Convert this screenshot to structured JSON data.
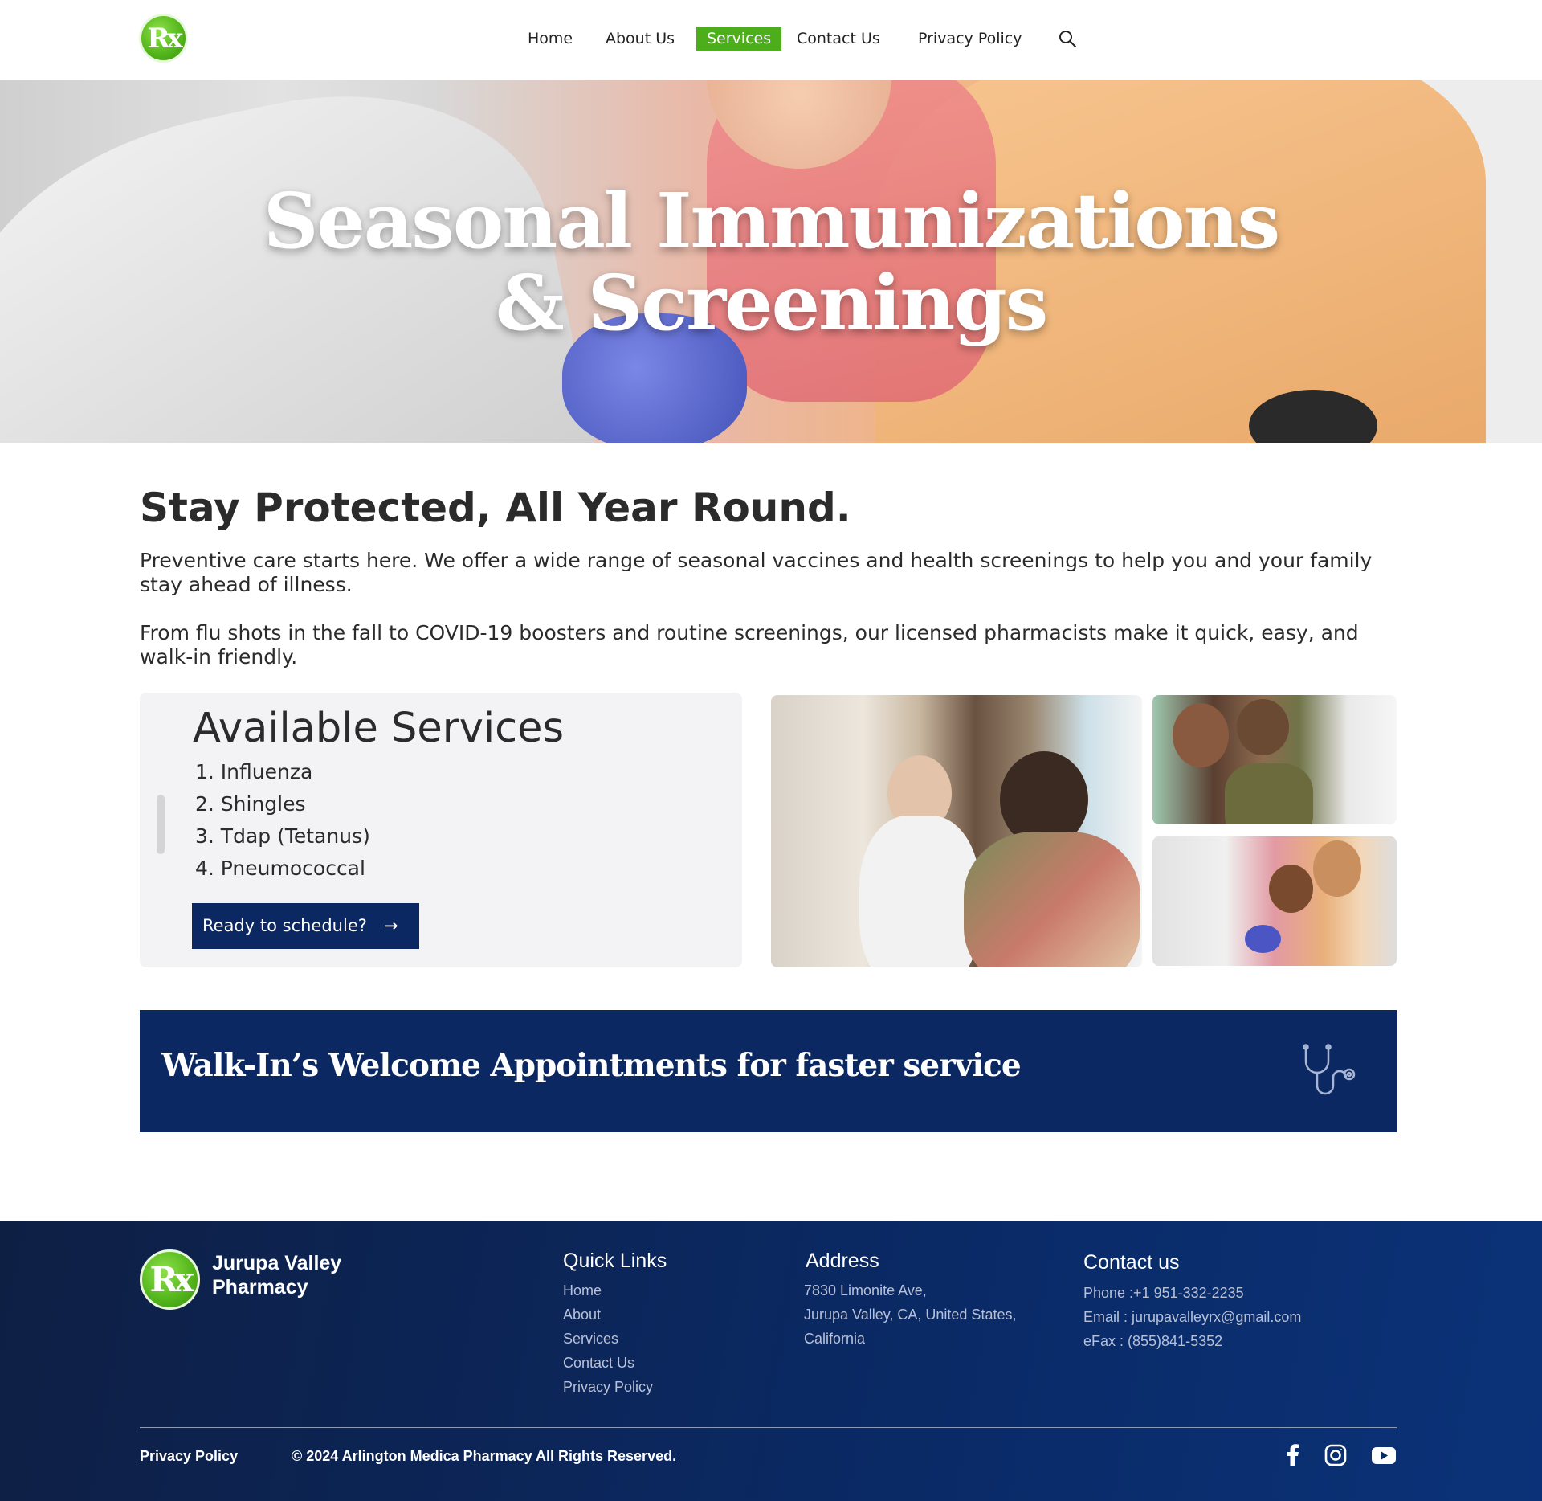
{
  "header": {
    "logo_text": "Rx",
    "nav": [
      "Home",
      "About Us",
      "Services",
      "Contact Us",
      "Privacy Policy"
    ],
    "active_nav": "Services",
    "accent_color": "#4cae1a"
  },
  "hero": {
    "title_line1": "Seasonal Immunizations",
    "title_line2": "& Screenings"
  },
  "intro": {
    "heading": "Stay Protected, All Year Round.",
    "paragraph1": "Preventive care starts here. We offer a wide range of seasonal vaccines and health screenings to help you and your family stay ahead of illness.",
    "paragraph2": "From flu shots in the fall to COVID-19 boosters and routine screenings, our licensed pharmacists make it quick, easy, and walk-in friendly."
  },
  "services": {
    "title": "Available Services",
    "items": [
      "1.  Influenza",
      "2. Shingles",
      "3. Tdap (Tetanus)",
      "4. Pneumococcal"
    ],
    "cta_label": "Ready to schedule?",
    "cta_arrow": "→"
  },
  "banner": {
    "text": "Walk-In’s Welcome Appointments for faster service",
    "icon": "stethoscope-icon",
    "color": "#0b2863"
  },
  "footer": {
    "logo_text": "Rx",
    "brand": "Jurupa Valley Pharmacy",
    "quick_links_heading": "Quick Links",
    "quick_links": [
      "Home",
      "About",
      "Services",
      "Contact Us",
      "Privacy Policy"
    ],
    "address_heading": "Address",
    "address_lines": [
      "7830 Limonite Ave,",
      "Jurupa Valley, CA, United States,",
      "California"
    ],
    "contact_heading": "Contact us",
    "contact_lines": [
      "Phone :+1 951-332-2235",
      "Email : jurupavalleyrx@gmail.com",
      "eFax : (855)841-5352"
    ],
    "privacy_link": "Privacy Policy",
    "copyright": "© 2024 Arlington Medica Pharmacy All Rights Reserved.",
    "social": [
      "facebook-icon",
      "instagram-icon",
      "youtube-icon"
    ]
  }
}
